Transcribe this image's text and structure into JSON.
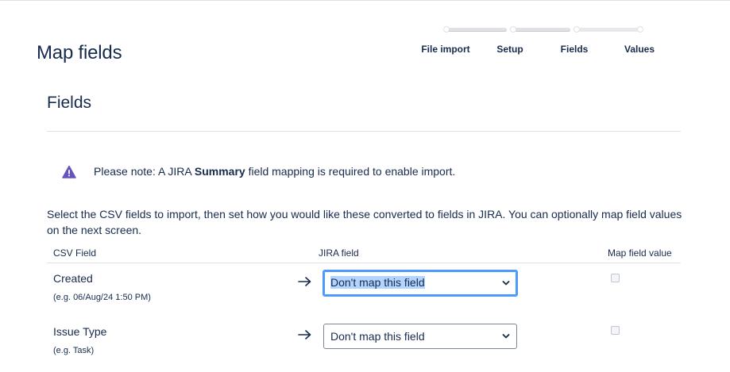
{
  "page": {
    "title": "Map fields"
  },
  "tracker": {
    "steps": [
      {
        "label": "File import"
      },
      {
        "label": "Setup"
      },
      {
        "label": "Fields"
      },
      {
        "label": "Values"
      }
    ],
    "current_step": 3
  },
  "section": {
    "title": "Fields"
  },
  "notice": {
    "prefix": "Please note: A JIRA ",
    "bold": "Summary",
    "suffix": " field mapping is required to enable import.",
    "icon": "warning-triangle-icon",
    "icon_color": "#6554c0"
  },
  "intro": "Select the CSV fields to import, then set how you would like these converted to fields in JIRA. You can optionally map field values on the next screen.",
  "table": {
    "headers": {
      "csv": "CSV Field",
      "jira": "JIRA field",
      "map": "Map field value"
    },
    "rows": [
      {
        "name": "Created",
        "example": "(e.g. 06/Aug/24 1:50 PM)",
        "selected": "Don't map this field",
        "map_value": false,
        "focused": true
      },
      {
        "name": "Issue Type",
        "example": "(e.g. Task)",
        "selected": "Don't map this field",
        "map_value": false,
        "focused": false
      }
    ]
  },
  "colors": {
    "text": "#172b4d",
    "focus": "#4c9aff",
    "highlight": "#b3d4ff"
  }
}
